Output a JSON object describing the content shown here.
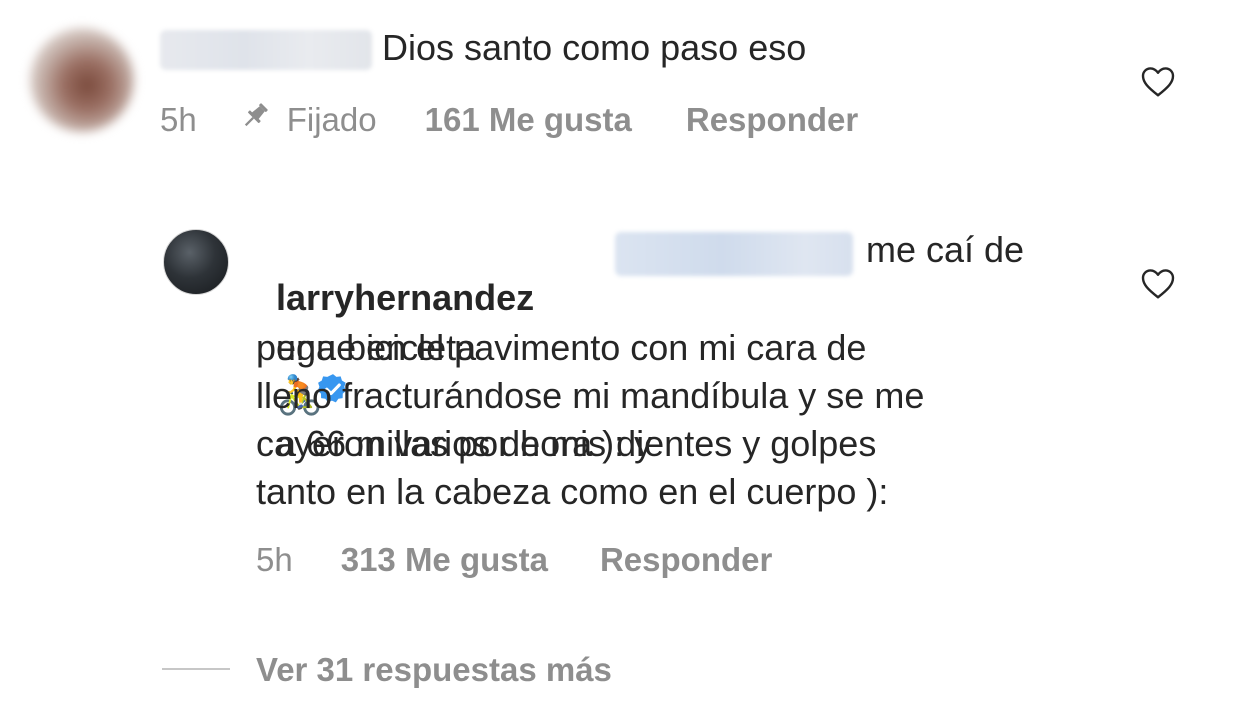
{
  "comment1": {
    "text": "Dios santo como paso eso",
    "time": "5h",
    "pinned": "Fijado",
    "likes": "161 Me gusta",
    "reply": "Responder"
  },
  "reply1": {
    "username": "larryhernandez",
    "line1_after_mention": "me caí de",
    "line2_before_emoji": "una bicicleta",
    "line2_after_emoji": "a 66 millas por hora ): y",
    "lines": [
      "pegue en el pavimento con mi cara de",
      "lleno fracturándose mi mandíbula y se me",
      "cayeron varios de mis dientes y golpes",
      "tanto en la cabeza como en el cuerpo ):"
    ],
    "emoji": "🚴",
    "time": "5h",
    "likes": "313 Me gusta",
    "reply": "Responder"
  },
  "view_more": "Ver 31 respuestas más",
  "colors": {
    "text": "#262626",
    "meta": "#8e8e8e",
    "verified": "#3897f0"
  }
}
